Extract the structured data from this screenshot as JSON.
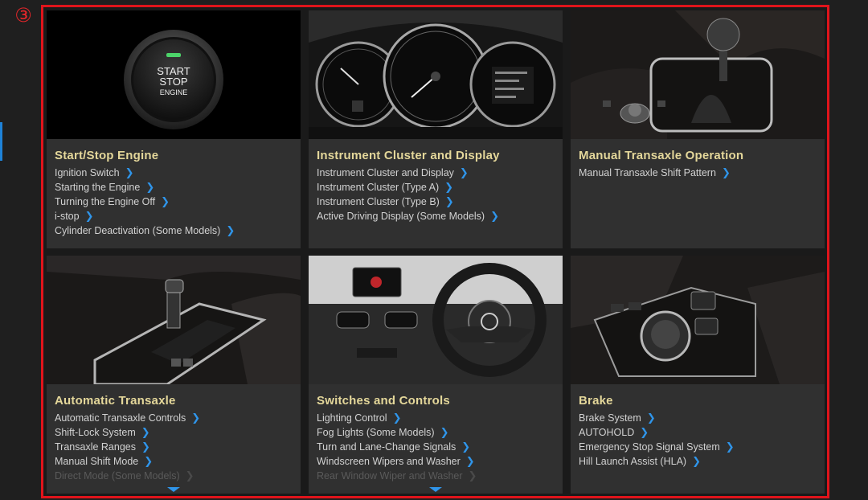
{
  "marker": "③",
  "cards": [
    {
      "title": "Start/Stop Engine",
      "image": "start-stop-engine-button",
      "button_text": [
        "START",
        "STOP",
        "ENGINE"
      ],
      "links": [
        "Ignition Switch",
        "Starting the Engine",
        "Turning the Engine Off",
        "i-stop",
        "Cylinder Deactivation (Some Models)"
      ]
    },
    {
      "title": "Instrument Cluster and Display",
      "image": "instrument-cluster",
      "links": [
        "Instrument Cluster and Display",
        "Instrument Cluster (Type A)",
        "Instrument Cluster (Type B)",
        "Active Driving Display (Some Models)"
      ]
    },
    {
      "title": "Manual Transaxle Operation",
      "image": "manual-gear-shifter",
      "links": [
        "Manual Transaxle Shift Pattern"
      ]
    },
    {
      "title": "Automatic Transaxle",
      "image": "automatic-gear-selector",
      "links": [
        "Automatic Transaxle Controls",
        "Shift-Lock System",
        "Transaxle Ranges",
        "Manual Shift Mode",
        "Direct Mode (Some Models)"
      ]
    },
    {
      "title": "Switches and Controls",
      "image": "dashboard-steering-wheel",
      "links": [
        "Lighting Control",
        "Fog Lights (Some Models)",
        "Turn and Lane-Change Signals",
        "Windscreen Wipers and Washer",
        "Rear Window Wiper and Washer"
      ]
    },
    {
      "title": "Brake",
      "image": "brake-controls",
      "links": [
        "Brake System",
        "AUTOHOLD",
        "Emergency Stop Signal System",
        "Hill Launch Assist (HLA)"
      ]
    }
  ],
  "colors": {
    "frame": "#e0141b",
    "title": "#e4d79a",
    "chevron": "#2f95ea",
    "card": "#303030"
  },
  "chevron_glyph": "❯"
}
